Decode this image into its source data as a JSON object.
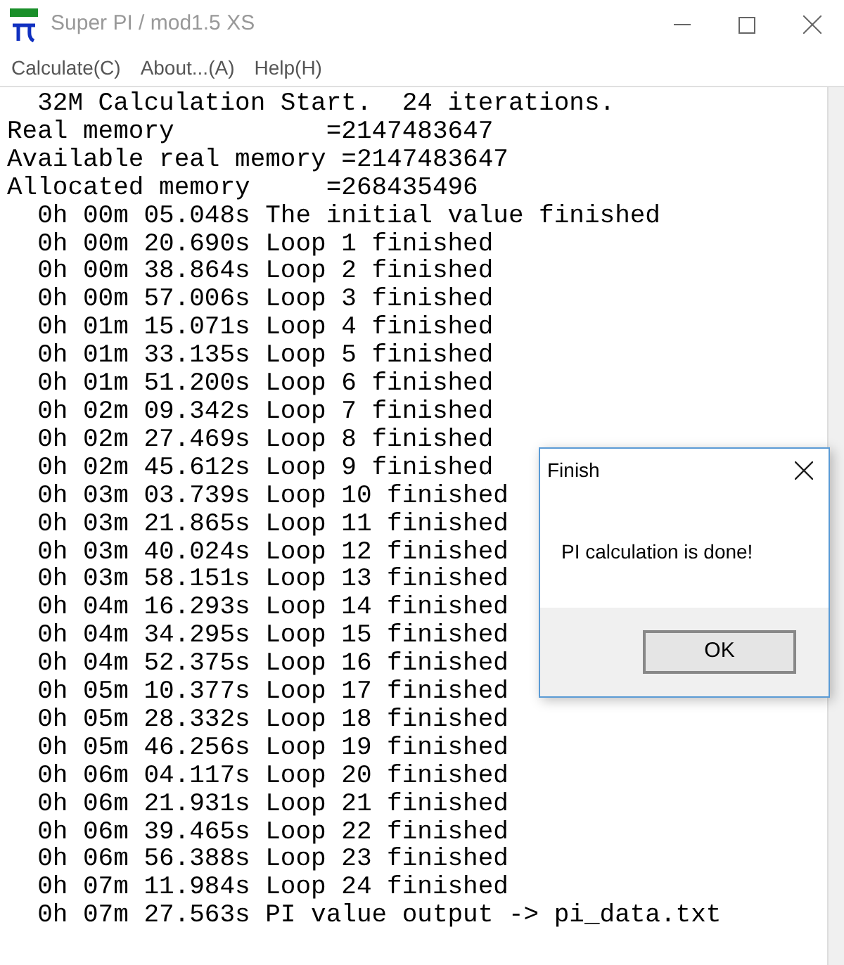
{
  "window": {
    "title": "Super PI / mod1.5 XS"
  },
  "menu": [
    {
      "label": "Calculate(C)"
    },
    {
      "label": "About...(A)"
    },
    {
      "label": "Help(H)"
    }
  ],
  "output_lines": [
    "  32M Calculation Start.  24 iterations.",
    "Real memory          =2147483647",
    "Available real memory =2147483647",
    "Allocated memory     =268435496",
    "  0h 00m 05.048s The initial value finished",
    "  0h 00m 20.690s Loop 1 finished",
    "  0h 00m 38.864s Loop 2 finished",
    "  0h 00m 57.006s Loop 3 finished",
    "  0h 01m 15.071s Loop 4 finished",
    "  0h 01m 33.135s Loop 5 finished",
    "  0h 01m 51.200s Loop 6 finished",
    "  0h 02m 09.342s Loop 7 finished",
    "  0h 02m 27.469s Loop 8 finished",
    "  0h 02m 45.612s Loop 9 finished",
    "  0h 03m 03.739s Loop 10 finished",
    "  0h 03m 21.865s Loop 11 finished",
    "  0h 03m 40.024s Loop 12 finished",
    "  0h 03m 58.151s Loop 13 finished",
    "  0h 04m 16.293s Loop 14 finished",
    "  0h 04m 34.295s Loop 15 finished",
    "  0h 04m 52.375s Loop 16 finished",
    "  0h 05m 10.377s Loop 17 finished",
    "  0h 05m 28.332s Loop 18 finished",
    "  0h 05m 46.256s Loop 19 finished",
    "  0h 06m 04.117s Loop 20 finished",
    "  0h 06m 21.931s Loop 21 finished",
    "  0h 06m 39.465s Loop 22 finished",
    "  0h 06m 56.388s Loop 23 finished",
    "  0h 07m 11.984s Loop 24 finished",
    "  0h 07m 27.563s PI value output -> pi_data.txt"
  ],
  "dialog": {
    "title": "Finish",
    "message": "PI calculation is done!",
    "button": "OK"
  }
}
